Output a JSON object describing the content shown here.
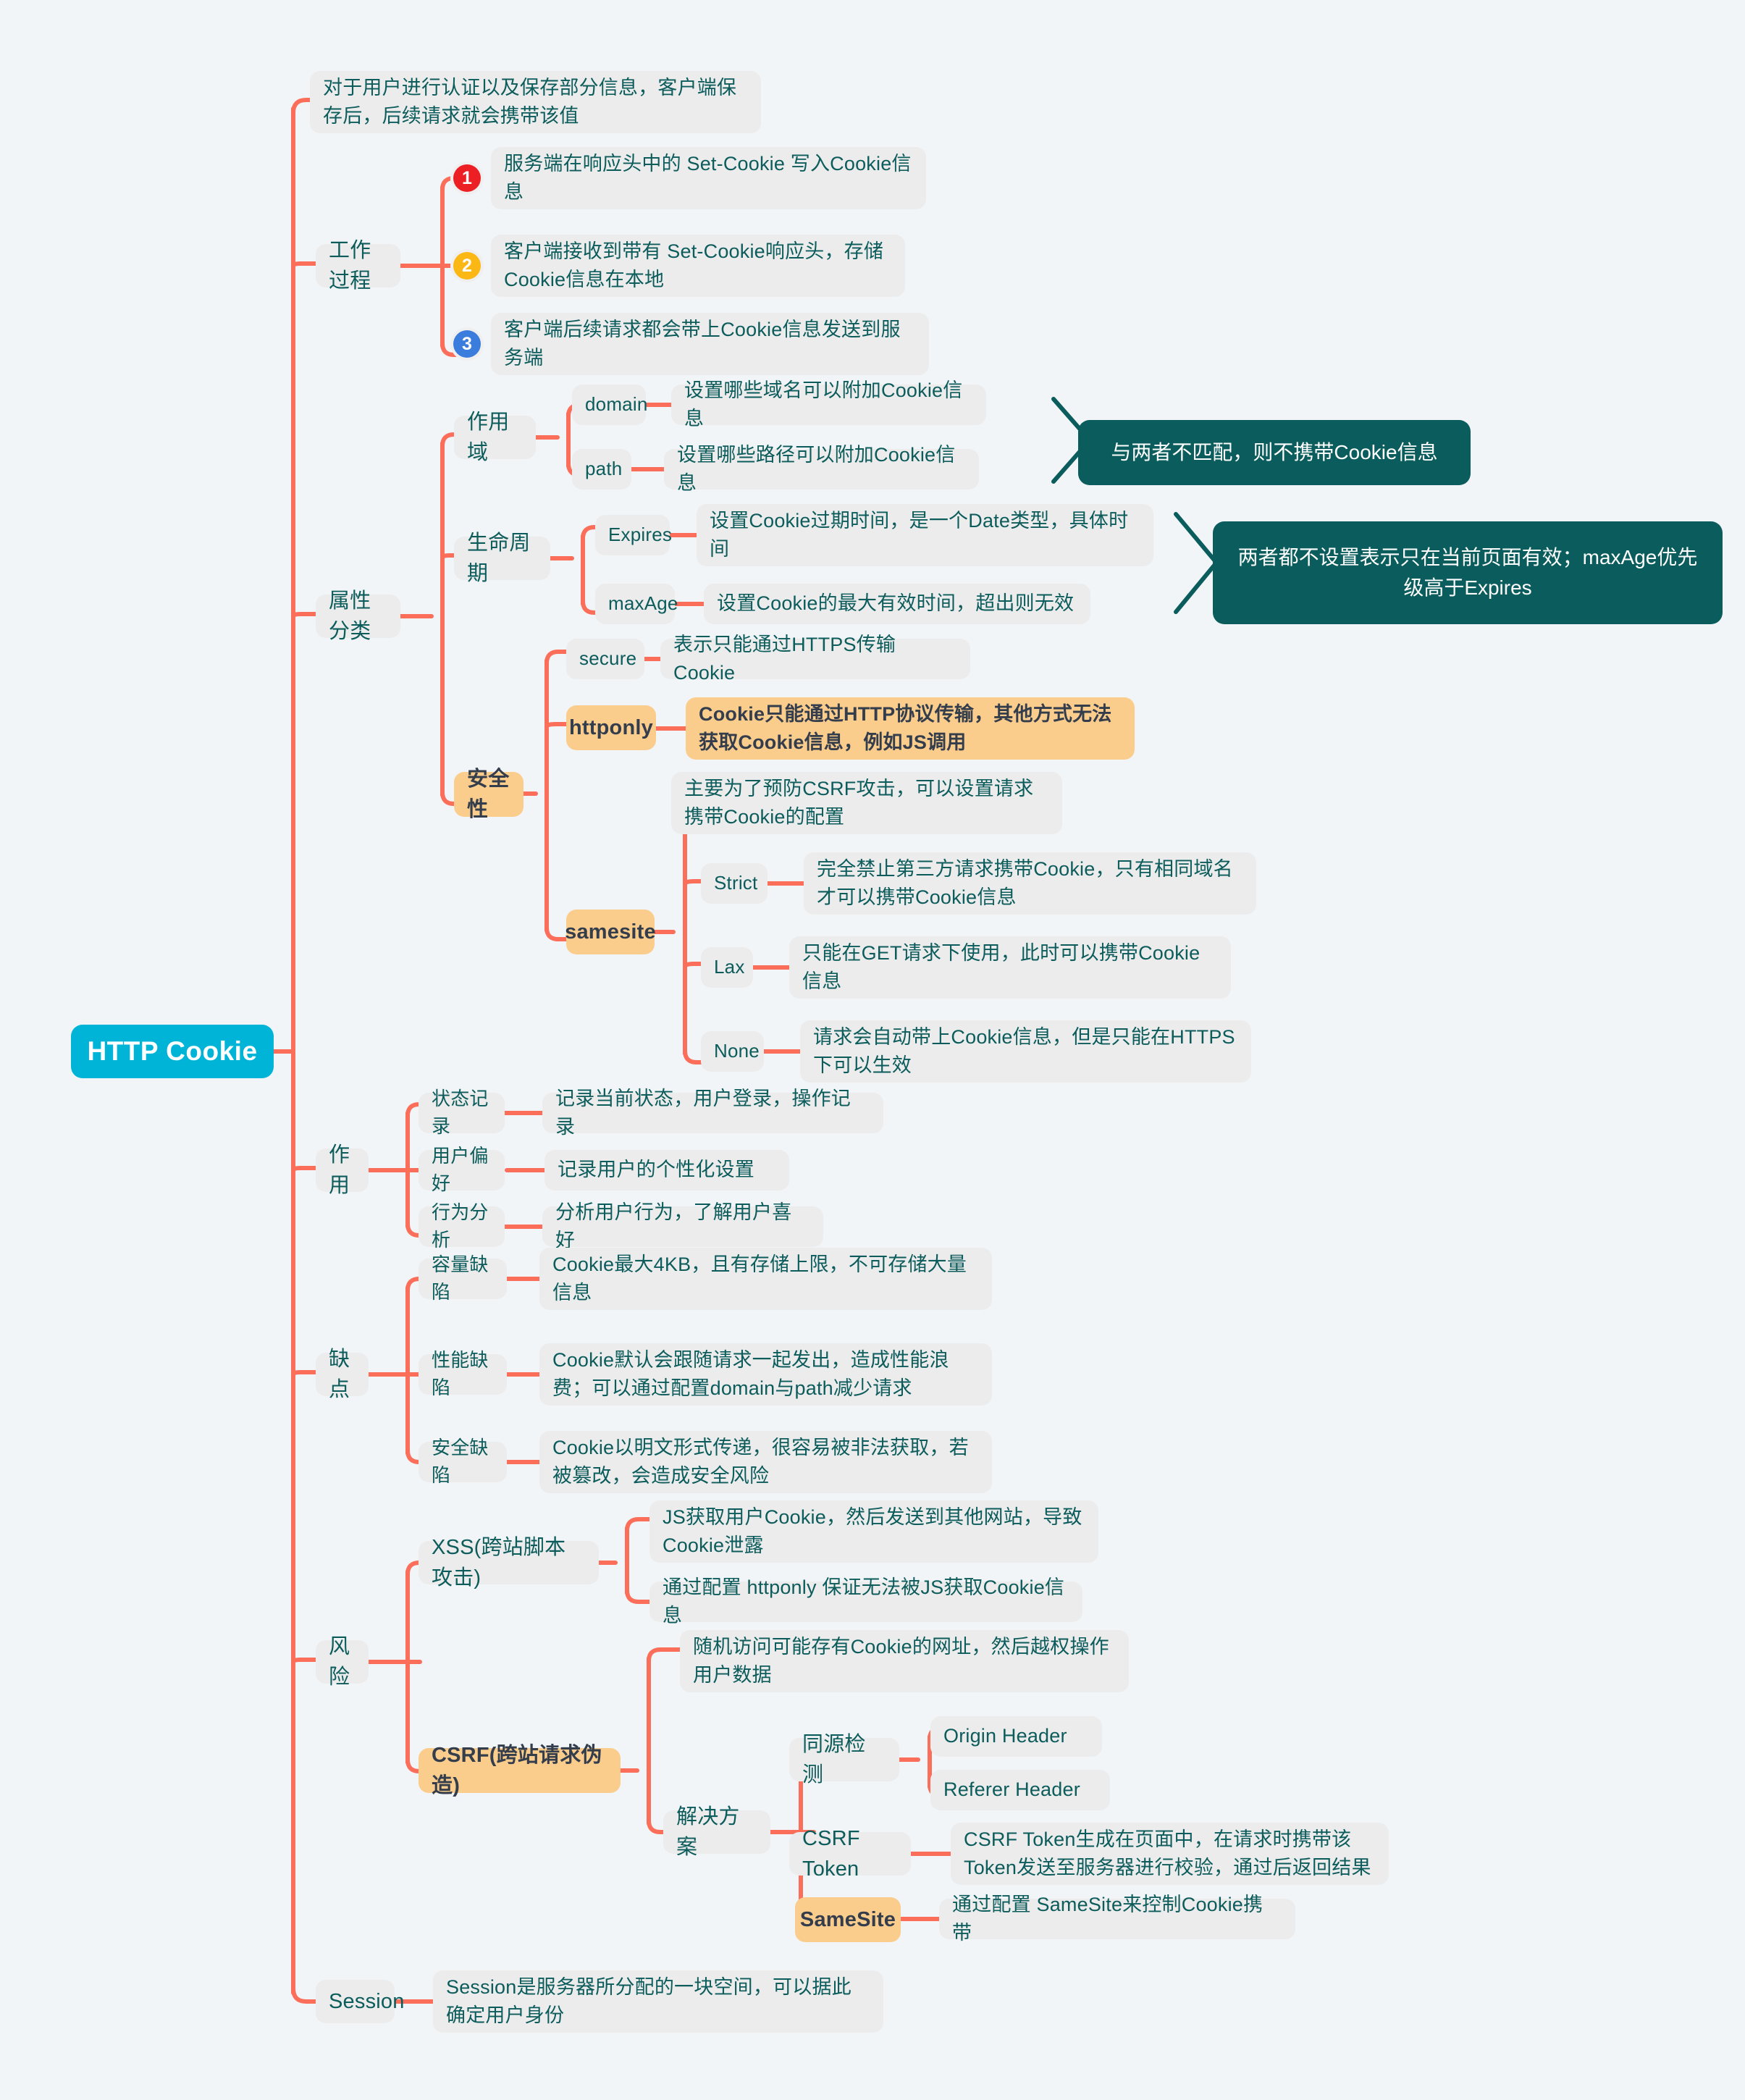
{
  "root": {
    "label": "HTTP Cookie",
    "color": "#00b4d8"
  },
  "colors": {
    "branch": "#fa6e5a",
    "text": "#0d5c5c",
    "node_bg": "#ececec",
    "highlight": "#fbcd8d",
    "highlight_text": "#333d4c",
    "callout": "#0b5c5c",
    "badge_1": "#ec2024",
    "badge_2": "#fbb714",
    "badge_3": "#3b7ddd",
    "page_bg": "#f1f5f8"
  },
  "intro": {
    "text": "对于用户进行认证以及保存部分信息，客户端保存后，后续请求就会携带该值"
  },
  "branches": {
    "process": {
      "label": "工作过程",
      "steps": [
        {
          "num": "❶",
          "badge": "1",
          "text": "服务端在响应头中的 Set-Cookie 写入Cookie信息"
        },
        {
          "num": "❷",
          "badge": "2",
          "text": "客户端接收到带有 Set-Cookie响应头，存储Cookie信息在本地"
        },
        {
          "num": "❸",
          "badge": "3",
          "text": "客户端后续请求都会带上Cookie信息发送到服务端"
        }
      ]
    },
    "attributes": {
      "label": "属性分类",
      "scope": {
        "label": "作用域",
        "items": [
          {
            "name": "domain",
            "desc": "设置哪些域名可以附加Cookie信息"
          },
          {
            "name": "path",
            "desc": "设置哪些路径可以附加Cookie信息"
          }
        ],
        "callout": "与两者不匹配，则不携带Cookie信息"
      },
      "lifecycle": {
        "label": "生命周期",
        "items": [
          {
            "name": "Expires",
            "desc": "设置Cookie过期时间，是一个Date类型，具体时间"
          },
          {
            "name": "maxAge",
            "desc": "设置Cookie的最大有效时间，超出则无效"
          }
        ],
        "callout": "两者都不设置表示只在当前页面有效；maxAge优先级高于Expires"
      },
      "security": {
        "label": "安全性",
        "secure": {
          "name": "secure",
          "desc": "表示只能通过HTTPS传输Cookie"
        },
        "httponly": {
          "name": "httponly",
          "desc": "Cookie只能通过HTTP协议传输，其他方式无法获取Cookie信息，例如JS调用"
        },
        "samesite": {
          "name": "samesite",
          "desc": "主要为了预防CSRF攻击，可以设置请求携带Cookie的配置",
          "values": [
            {
              "name": "Strict",
              "desc": "完全禁止第三方请求携带Cookie，只有相同域名才可以携带Cookie信息"
            },
            {
              "name": "Lax",
              "desc": "只能在GET请求下使用，此时可以携带Cookie信息"
            },
            {
              "name": "None",
              "desc": "请求会自动带上Cookie信息，但是只能在HTTPS下可以生效"
            }
          ]
        }
      }
    },
    "usage": {
      "label": "作用",
      "items": [
        {
          "name": "状态记录",
          "desc": "记录当前状态，用户登录，操作记录"
        },
        {
          "name": "用户偏好",
          "desc": "记录用户的个性化设置"
        },
        {
          "name": "行为分析",
          "desc": "分析用户行为，了解用户喜好"
        }
      ]
    },
    "drawbacks": {
      "label": "缺点",
      "items": [
        {
          "name": "容量缺陷",
          "desc": "Cookie最大4KB，且有存储上限，不可存储大量信息"
        },
        {
          "name": "性能缺陷",
          "desc": "Cookie默认会跟随请求一起发出，造成性能浪费；可以通过配置domain与path减少请求"
        },
        {
          "name": "安全缺陷",
          "desc": "Cookie以明文形式传递，很容易被非法获取，若被篡改，会造成安全风险"
        }
      ]
    },
    "risks": {
      "label": "风险",
      "xss": {
        "name": "XSS(跨站脚本攻击)",
        "items": [
          "JS获取用户Cookie，然后发送到其他网站，导致Cookie泄露",
          "通过配置 httponly 保证无法被JS获取Cookie信息"
        ]
      },
      "csrf": {
        "name": "CSRF(跨站请求伪造)",
        "desc": "随机访问可能存有Cookie的网址，然后越权操作用户数据",
        "solution": {
          "label": "解决方案",
          "same_origin": {
            "name": "同源检测",
            "items": [
              "Origin Header",
              "Referer Header"
            ]
          },
          "csrf_token": {
            "name": "CSRF Token",
            "desc": "CSRF Token生成在页面中，在请求时携带该Token发送至服务器进行校验，通过后返回结果"
          },
          "samesite": {
            "name": "SameSite",
            "desc": "通过配置 SameSite来控制Cookie携带"
          }
        }
      }
    },
    "session": {
      "label": "Session",
      "desc": "Session是服务器所分配的一块空间，可以据此确定用户身份"
    }
  }
}
